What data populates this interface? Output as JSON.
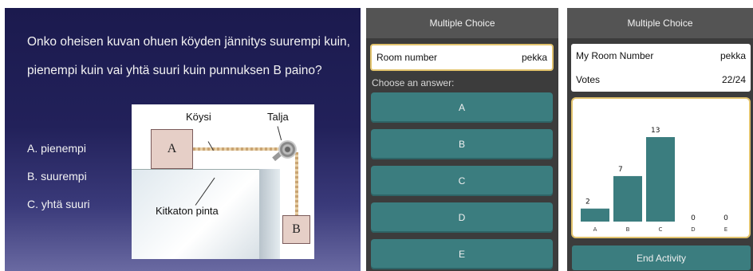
{
  "slide": {
    "question": "Onko oheisen kuvan ohuen köyden jännitys suurempi kuin, pienempi kuin vai yhtä suuri kuin punnuksen B paino?",
    "options": [
      "A.  pienempi",
      "B.  suurempi",
      "C.  yhtä suuri"
    ],
    "figure": {
      "label_rope": "Köysi",
      "label_pulley": "Talja",
      "label_surface": "Kitkaton pinta",
      "box_a": "A",
      "box_b": "B"
    }
  },
  "answer_screen": {
    "header": "Multiple Choice",
    "room_label": "Room number",
    "room_value": "pekka",
    "choose_label": "Choose an answer:",
    "answers": [
      "A",
      "B",
      "C",
      "D",
      "E"
    ],
    "colors": {
      "button": "#3b7d7f",
      "highlight_border": "#e2c36d"
    }
  },
  "results_screen": {
    "header": "Multiple Choice",
    "room_label": "My Room Number",
    "room_value": "pekka",
    "votes_label": "Votes",
    "votes_value": "22/24",
    "end_button": "End Activity"
  },
  "chart_data": {
    "type": "bar",
    "categories": [
      "A",
      "B",
      "C",
      "D",
      "E"
    ],
    "values": [
      2,
      7,
      13,
      0,
      0
    ],
    "color": "#3b7d7f",
    "ylim": [
      0,
      13
    ]
  }
}
